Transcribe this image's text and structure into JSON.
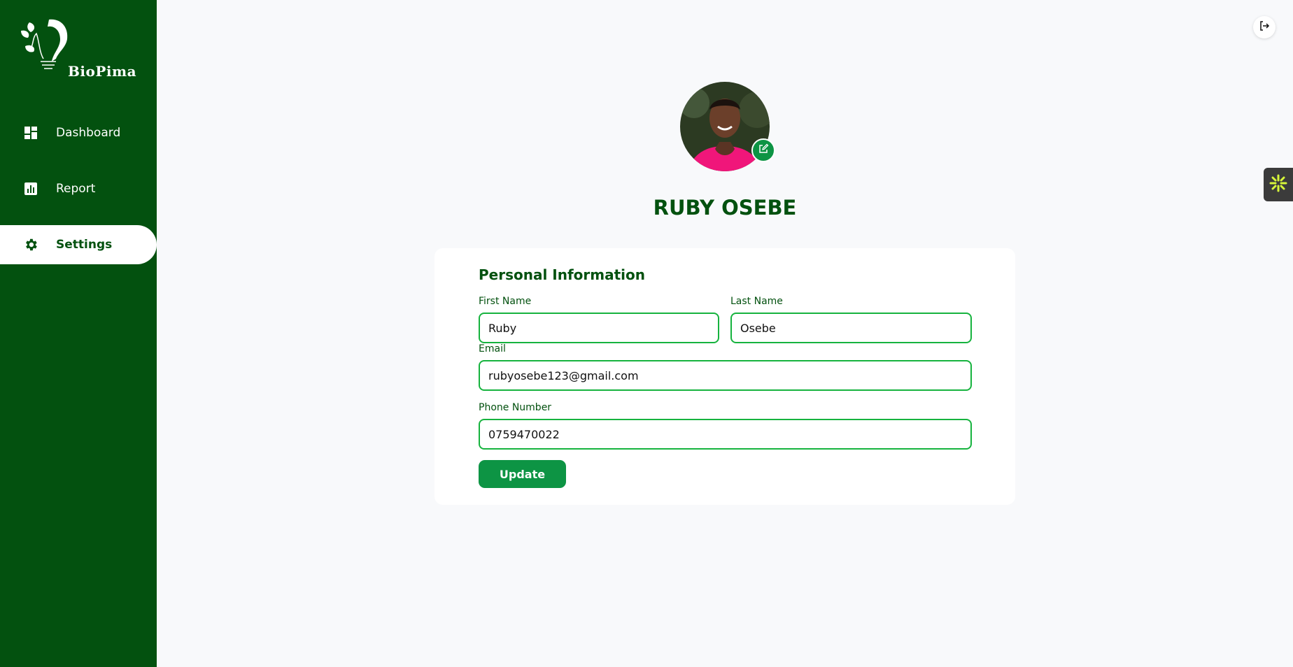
{
  "brand": {
    "name": "BioPima"
  },
  "sidebar": {
    "items": [
      {
        "label": "Dashboard",
        "icon": "dashboard-icon"
      },
      {
        "label": "Report",
        "icon": "bar-chart-icon"
      },
      {
        "label": "Settings",
        "icon": "gear-icon",
        "active": true
      }
    ]
  },
  "header": {
    "logout_icon": "logout-icon",
    "widget_icon": "sparkle-icon"
  },
  "profile": {
    "name": "RUBY OSEBE",
    "edit_icon": "edit-icon"
  },
  "form": {
    "title": "Personal Information",
    "first_name": {
      "label": "First Name",
      "value": "Ruby"
    },
    "last_name": {
      "label": "Last Name",
      "value": "Osebe"
    },
    "email": {
      "label": "Email",
      "value": "rubyosebe123@gmail.com"
    },
    "phone": {
      "label": "Phone Number",
      "value": "0759470022"
    },
    "submit_label": "Update"
  },
  "colors": {
    "sidebar_bg": "#03510f",
    "accent": "#0d9444",
    "input_border": "#16b33e",
    "page_bg": "#f8f9fb"
  }
}
